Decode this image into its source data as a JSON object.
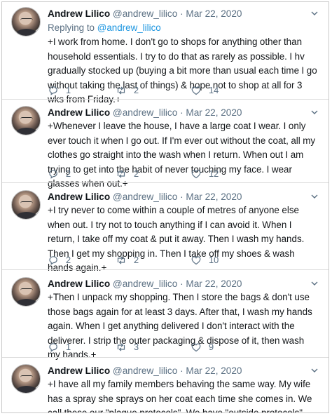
{
  "tweets": [
    {
      "name": "Andrew Lilico",
      "handle": "@andrew_lilico",
      "separator": "·",
      "date": "Mar 22, 2020",
      "replying_prefix": "Replying to",
      "replying_to": "@andrew_lilico",
      "text": "+I work from home. I don't go to shops for anything other than household essentials. I try to do that as rarely as possible. I hv gradually stocked up (buying a bit more than usual each time I go without taking the last of things) & hope not to shop at all for 3 wks from Friday.+",
      "replies": "1",
      "retweets": "2",
      "likes": "14"
    },
    {
      "name": "Andrew Lilico",
      "handle": "@andrew_lilico",
      "separator": "·",
      "date": "Mar 22, 2020",
      "text": "+Whenever I leave the house, I have a large coat I wear. I only ever touch it when I go out. If I'm ever out without the coat, all my clothes go straight into the wash when I return. When out I am trying to get into the habit of never touching my face. I wear glasses when out.+",
      "replies": "2",
      "retweets": "2",
      "likes": "12"
    },
    {
      "name": "Andrew Lilico",
      "handle": "@andrew_lilico",
      "separator": "·",
      "date": "Mar 22, 2020",
      "text": "+I try never to come within a couple of metres of anyone else when out. I try not to touch anything if I can avoid it. When I return, I take off my coat & put it away. Then I wash my hands. Then I get my shopping in. Then I take off my shoes & wash hands again.+",
      "replies": "2",
      "retweets": "2",
      "likes": "10"
    },
    {
      "name": "Andrew Lilico",
      "handle": "@andrew_lilico",
      "separator": "·",
      "date": "Mar 22, 2020",
      "text": "+Then I unpack my shopping. Then I store the bags & don't use those bags again for at least 3 days. After that, I wash my hands again. When I get anything delivered I don't interact with the deliverer. I strip the outer packaging & dispose of it, then wash my hands.+",
      "replies": "1",
      "retweets": "3",
      "likes": "9"
    },
    {
      "name": "Andrew Lilico",
      "handle": "@andrew_lilico",
      "separator": "·",
      "date": "Mar 22, 2020",
      "text": "+I have all my family members behaving the same way. My wife has a spray she sprays on her coat each time she comes in. We call these our \"plague protocols\". We have \"outside protocols\" and \"inside protocols\".+"
    }
  ],
  "icons": {
    "reply": "reply-icon",
    "retweet": "retweet-icon",
    "like": "heart-icon",
    "more": "chevron-down-icon"
  },
  "colors": {
    "name": "#0f1419",
    "meta": "#5b7083",
    "link": "#1b95e0",
    "divider": "#dcdcdc"
  }
}
